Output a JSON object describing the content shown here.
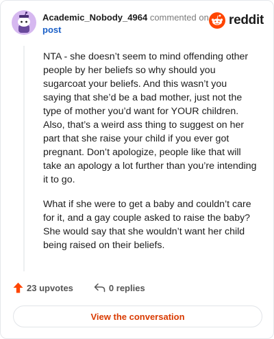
{
  "header": {
    "username": "Academic_Nobody_4964",
    "commented_text": "commented on",
    "post_link": "post",
    "logo_text": "reddit"
  },
  "comment": {
    "paragraphs": [
      "NTA - she doesn’t seem to mind offending other people by her beliefs so why should you sugarcoat your beliefs. And this wasn’t you saying that she’d be a bad mother, just not the type of mother you’d want for YOUR children. Also, that’s a weird ass thing to suggest on her part that she raise your child if you ever got pregnant. Don’t apologize, people like that will take an apology a lot further than you’re intending it to go.",
      "What if she were to get a baby and couldn’t care for it, and a gay couple asked to raise the baby? She would say that she wouldn’t want her child being raised on their beliefs."
    ]
  },
  "footer": {
    "upvotes": "23 upvotes",
    "replies": "0 replies",
    "view_button": "View the conversation"
  },
  "colors": {
    "accent": "#d93a00",
    "upvote": "#ff4500",
    "link": "#1a5fc7",
    "avatar_bg": "#d6b8f0"
  },
  "icons": {
    "avatar": "snoo-avatar-icon",
    "logo": "reddit-logo-icon",
    "upvote": "upvote-arrow-icon",
    "reply": "reply-arrow-icon"
  }
}
